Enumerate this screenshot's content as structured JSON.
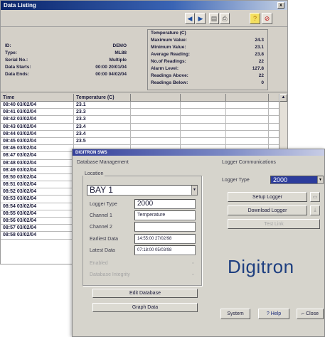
{
  "listing": {
    "title": "Data Listing",
    "close": "x",
    "info_left": [
      {
        "label": "ID:",
        "value": "DEMO"
      },
      {
        "label": "Type:",
        "value": "ML88"
      },
      {
        "label": "Serial No.:",
        "value": "Multiple"
      },
      {
        "label": "Data Starts:",
        "value": "00:00 20/01/04"
      },
      {
        "label": "Data Ends:",
        "value": "00:00 04/02/04"
      }
    ],
    "stats_title": "Temperature (C)",
    "stats": [
      {
        "label": "Maximum Value:",
        "value": "24.3"
      },
      {
        "label": "Minimum Value:",
        "value": "23.1"
      },
      {
        "label": "Average Reading:",
        "value": "23.8"
      },
      {
        "label": "No.of Readings:",
        "value": "22"
      },
      {
        "label": "Alarm Level:",
        "value": "127.8"
      },
      {
        "label": "Readings Above:",
        "value": "22"
      },
      {
        "label": "Readings Below:",
        "value": "0"
      }
    ],
    "columns": [
      "Time",
      "Temperature (C)"
    ],
    "rows": [
      [
        "08:40 03/02/04",
        "23.1"
      ],
      [
        "08:41 03/02/04",
        "23.3"
      ],
      [
        "08:42 03/02/04",
        "23.3"
      ],
      [
        "08:43 03/02/04",
        "23.4"
      ],
      [
        "08:44 03/02/04",
        "23.4"
      ],
      [
        "08:45 03/02/04",
        "23.5"
      ],
      [
        "08:46 03/02/04",
        ""
      ],
      [
        "08:47 03/02/04",
        ""
      ],
      [
        "08:48 03/02/04",
        ""
      ],
      [
        "08:49 03/02/04",
        ""
      ],
      [
        "08:50 03/02/04",
        ""
      ],
      [
        "08:51 03/02/04",
        ""
      ],
      [
        "08:52 03/02/04",
        ""
      ],
      [
        "08:53 03/02/04",
        ""
      ],
      [
        "08:54 03/02/04",
        ""
      ],
      [
        "08:55 03/02/04",
        ""
      ],
      [
        "08:56 03/02/04",
        ""
      ],
      [
        "08:57 03/02/04",
        ""
      ],
      [
        "08:58 03/02/04",
        ""
      ]
    ]
  },
  "software": {
    "title": "DIGITRON SWS",
    "db_section": "Database Management",
    "location_label": "Location",
    "location_value": "BAY 1",
    "logger_type_label": "Logger Type",
    "logger_type_value": "2000",
    "channel1_label": "Channel 1",
    "channel1_value": "Temperature",
    "channel2_label": "Channel 2",
    "channel2_value": "",
    "earliest_label": "Earliest Data",
    "earliest_value": "14:55:00 27/02/98",
    "latest_label": "Latest Data",
    "latest_value": "07:18:00 05/03/98",
    "faded1": "Enabled",
    "faded2": "Database Integrity",
    "edit_btn": "Edit Database",
    "graph_btn": "Graph Data",
    "comm_section": "Logger Communications",
    "comm_logger_type_label": "Logger Type",
    "comm_logger_type_value": "2000",
    "setup_btn": "Setup Logger",
    "download_btn": "Download Logger",
    "third_btn": "Test Link",
    "logo": "Digitron",
    "system_btn": "System",
    "help_btn": "? Help",
    "close_btn": "Close"
  },
  "colors": {
    "title_bar": "#0a246a",
    "logo": "#1e3f80",
    "window_face": "#d4d0c8"
  }
}
